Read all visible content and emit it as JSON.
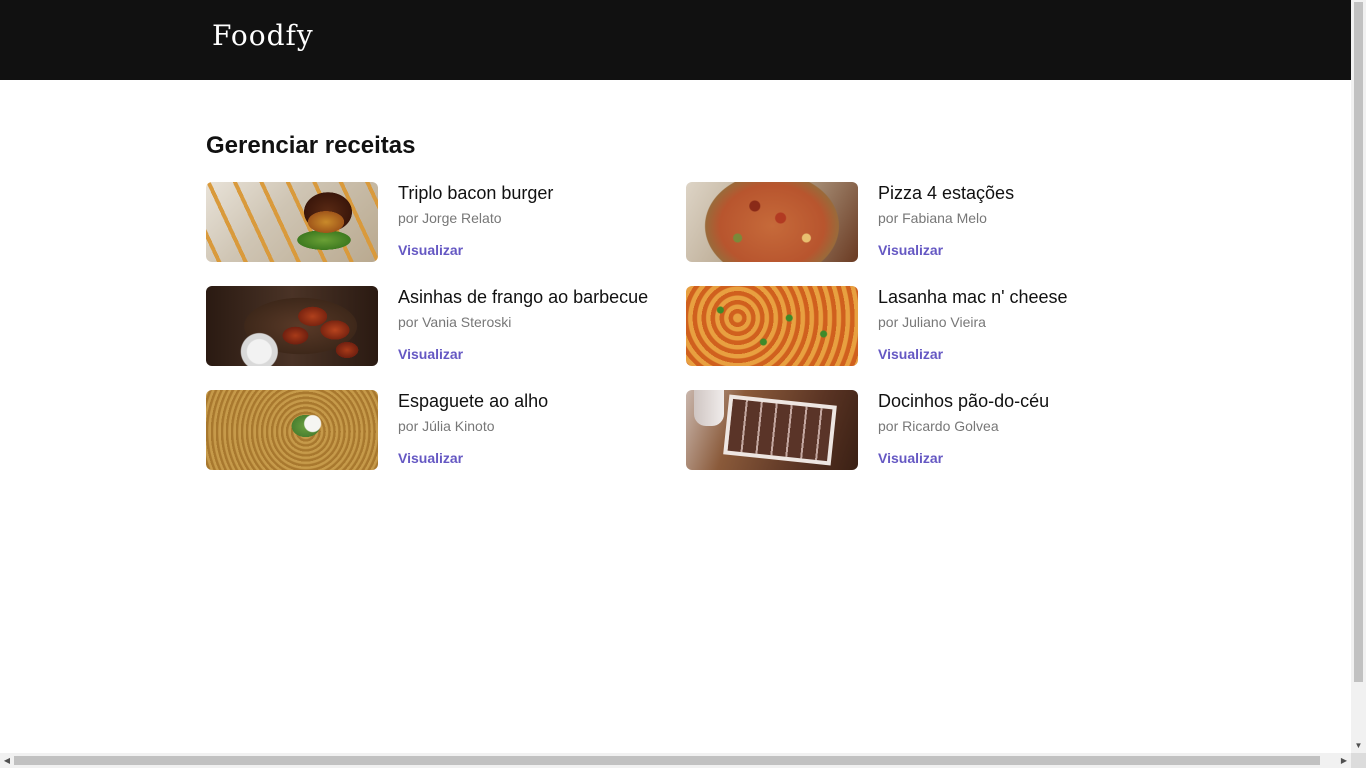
{
  "header": {
    "logo": "Foodfy"
  },
  "main": {
    "title": "Gerenciar receitas",
    "view_label": "Visualizar",
    "recipes": [
      {
        "title": "Triplo bacon burger",
        "author": "por Jorge Relato",
        "image": "burger-photo"
      },
      {
        "title": "Pizza 4 estações",
        "author": "por Fabiana Melo",
        "image": "pizza-photo"
      },
      {
        "title": "Asinhas de frango ao barbecue",
        "author": "por Vania Steroski",
        "image": "chicken-wings-photo"
      },
      {
        "title": "Lasanha mac n' cheese",
        "author": "por Juliano Vieira",
        "image": "lasagna-photo"
      },
      {
        "title": "Espaguete ao alho",
        "author": "por Júlia Kinoto",
        "image": "spaghetti-photo"
      },
      {
        "title": "Docinhos pão-do-céu",
        "author": "por Ricardo Golvea",
        "image": "sweets-photo"
      }
    ]
  },
  "colors": {
    "header_bg": "#111111",
    "link": "#6558c3",
    "author_text": "#777777"
  },
  "icons": {
    "scroll_up": "scroll-up-arrow-icon",
    "scroll_down": "scroll-down-arrow-icon",
    "scroll_left": "scroll-left-arrow-icon",
    "scroll_right": "scroll-right-arrow-icon"
  }
}
